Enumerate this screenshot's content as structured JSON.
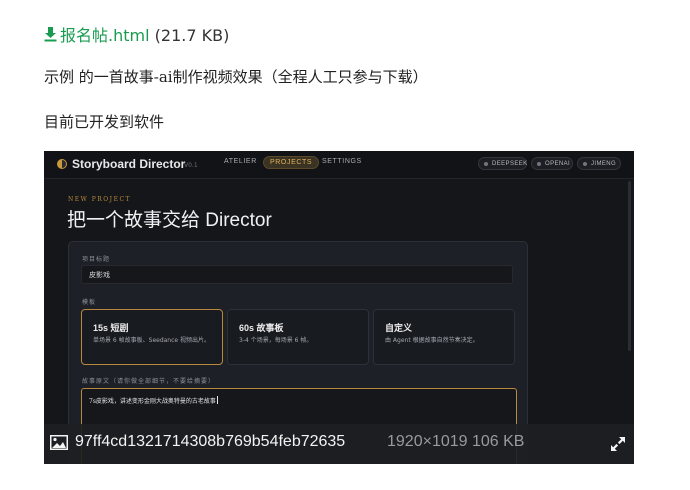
{
  "attachment": {
    "filename": "报名帖.html",
    "size": "(21.7 KB)"
  },
  "paragraphs": [
    "示例 的一首故事-ai制作视频效果（全程人工只参与下载）",
    "目前已开发到软件"
  ],
  "screenshot": {
    "app_title": "Storyboard Director",
    "version": "V0.1",
    "nav": [
      "ATELIER",
      "PROJECTS",
      "SETTINGS"
    ],
    "providers": [
      "DEEPSEEK",
      "OPENAI",
      "JIMENG"
    ],
    "eyebrow": "NEW PROJECT",
    "headline": "把一个故事交给 Director",
    "project_title_label": "项目标题",
    "project_title_value": "皮影戏",
    "template_label": "模板",
    "templates": [
      {
        "title": "15s 短剧",
        "desc": "单场景 6 帧故事板、Seedance 视频出片。"
      },
      {
        "title": "60s 故事板",
        "desc": "3-4 个场景，每场景 6 帧。"
      },
      {
        "title": "自定义",
        "desc": "由 Agent 根据故事自然节奏决定。"
      }
    ],
    "story_label": "故事原文（请你做全部细节，不要给摘要）",
    "story_text": "7s皮影戏，讲述变形金刚大战奥特曼的古老故事"
  },
  "image_info": {
    "hash": "97ff4cd1321714308b769b54feb72635",
    "meta": "1920×1019 106 KB"
  },
  "colors": {
    "link_green": "#1a9c50",
    "accent_gold": "#b8893c",
    "app_bg": "#14161a"
  }
}
